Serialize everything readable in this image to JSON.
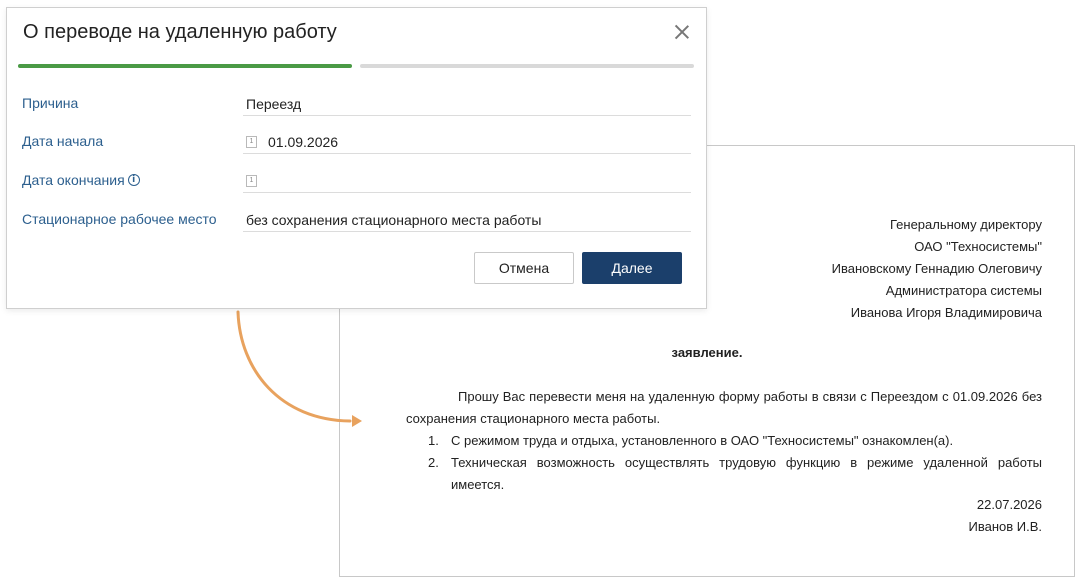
{
  "dialog": {
    "title": "О переводе на удаленную работу",
    "steps": [
      "active",
      "inactive"
    ],
    "fields": {
      "reason": {
        "label": "Причина",
        "value": "Переезд"
      },
      "start_date": {
        "label": "Дата начала",
        "value": "01.09.2026",
        "icon_text": "1"
      },
      "end_date": {
        "label": "Дата окончания",
        "value": "",
        "icon_text": "1",
        "info_icon_text": "i"
      },
      "workplace": {
        "label": "Стационарное рабочее место",
        "value": "без сохранения стационарного места работы"
      }
    },
    "buttons": {
      "cancel": "Отмена",
      "next": "Далее"
    },
    "colors": {
      "accent": "#4a9a45",
      "primary": "#1b3f6b",
      "label": "#2c5f8e"
    }
  },
  "document": {
    "addressee": [
      "Генеральному директору",
      "ОАО \"Техносистемы\"",
      "Ивановскому Геннадию Олеговичу",
      "Администратора системы",
      "Иванова Игоря Владимировича"
    ],
    "title": "заявление.",
    "paragraph": "Прошу Вас перевести меня на удаленную форму работы в связи с Переездом с 01.09.2026 без сохранения стационарного места работы.",
    "items": [
      {
        "num": "1.",
        "text": "С режимом труда и отдыха, установленного в ОАО \"Техносистемы\" ознакомлен(а)."
      },
      {
        "num": "2.",
        "text": "Техническая возможность осуществлять трудовую функцию в режиме удаленной работы имеется."
      }
    ],
    "date": "22.07.2026",
    "signature": "Иванов И.В."
  },
  "arrow_color": "#e8a25e"
}
